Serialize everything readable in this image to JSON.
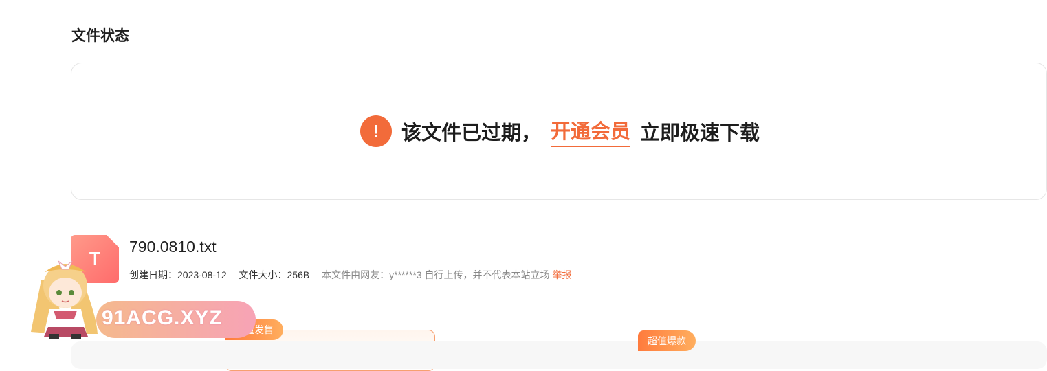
{
  "section_title": "文件状态",
  "status": {
    "icon": "exclamation-icon",
    "text_before": "该文件已过期，",
    "vip_link": "开通会员",
    "text_after": "立即极速下载"
  },
  "file": {
    "icon_letter": "T",
    "name": "790.0810.txt",
    "created_label": "创建日期：",
    "created_value": "2023-08-12",
    "size_label": "文件大小：",
    "size_value": "256B",
    "uploader_text": "本文件由网友：y******3 自行上传，并不代表本站立场",
    "report_link": "举报"
  },
  "overlay": {
    "watermark_text": "91ACG.XYZ"
  },
  "plans": {
    "badge_1": "限量发售",
    "badge_2": "超值爆款"
  },
  "colors": {
    "accent": "#f26b3a",
    "file_icon": "#ff7b72"
  }
}
